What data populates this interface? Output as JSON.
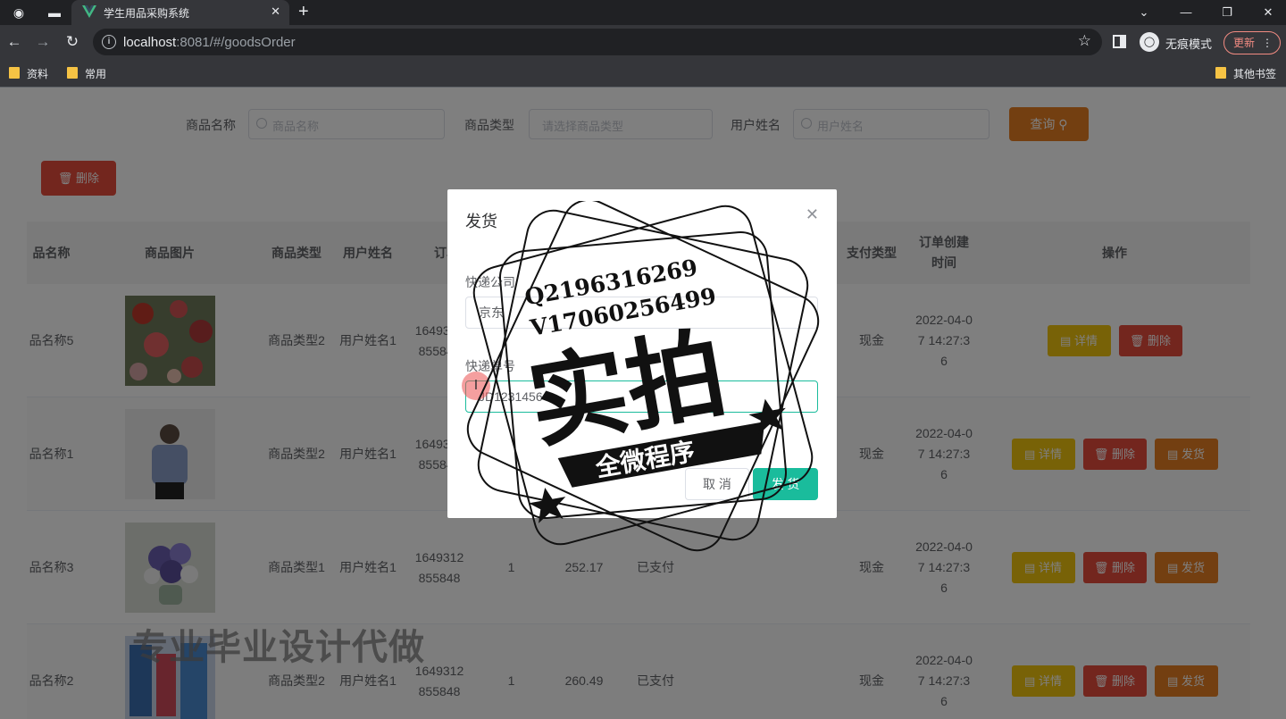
{
  "browser": {
    "tab_title": "学生用品采购系统",
    "url_host": "localhost",
    "url_rest": ":8081/#/goodsOrder",
    "incognito_label": "无痕模式",
    "update_label": "更新",
    "bookmarks": [
      "资料",
      "常用"
    ],
    "other_bookmarks": "其他书签"
  },
  "search": {
    "name_label": "商品名称",
    "name_placeholder": "商品名称",
    "type_label": "商品类型",
    "type_placeholder": "请选择商品类型",
    "user_label": "用户姓名",
    "user_placeholder": "用户姓名",
    "query_label": "查询"
  },
  "delete_label": "删除",
  "table": {
    "headers": {
      "name": "品名称",
      "image": "商品图片",
      "type": "商品类型",
      "user": "用户姓名",
      "order": "订单",
      "pay_type": "支付类型",
      "created": "订单创建时间",
      "ops": "操作"
    },
    "rows": [
      {
        "name": "品名称5",
        "type": "商品类型2",
        "user": "用户姓名1",
        "order": "1649312855848",
        "qty": "",
        "price": "",
        "status": "",
        "pay": "现金",
        "created": "2022-04-07 14:27:36"
      },
      {
        "name": "品名称1",
        "type": "商品类型2",
        "user": "用户姓名1",
        "order": "1649312855848",
        "qty": "",
        "price": "",
        "status": "",
        "pay": "现金",
        "created": "2022-04-07 14:27:36"
      },
      {
        "name": "品名称3",
        "type": "商品类型1",
        "user": "用户姓名1",
        "order": "1649312855848",
        "qty": "1",
        "price": "252.17",
        "status": "已支付",
        "pay": "现金",
        "created": "2022-04-07 14:27:36"
      },
      {
        "name": "品名称2",
        "type": "商品类型2",
        "user": "用户姓名1",
        "order": "1649312855848",
        "qty": "1",
        "price": "260.49",
        "status": "已支付",
        "pay": "现金",
        "created": "2022-04-07 14:27:36"
      }
    ],
    "btn_detail": "详情",
    "btn_delete": "删除",
    "btn_ship": "发货"
  },
  "dialog": {
    "title": "发货",
    "company_label": "快递公司",
    "company_value": "京东",
    "tracking_label": "快递单号",
    "tracking_value": "JD12314564",
    "cancel_label": "取 消",
    "confirm_label": "发 货"
  },
  "watermark": {
    "qq": "Q2196316269",
    "vx": "V17060256499",
    "big": "实拍",
    "banner": "全微程序",
    "bottom": "专业毕业设计代做"
  }
}
